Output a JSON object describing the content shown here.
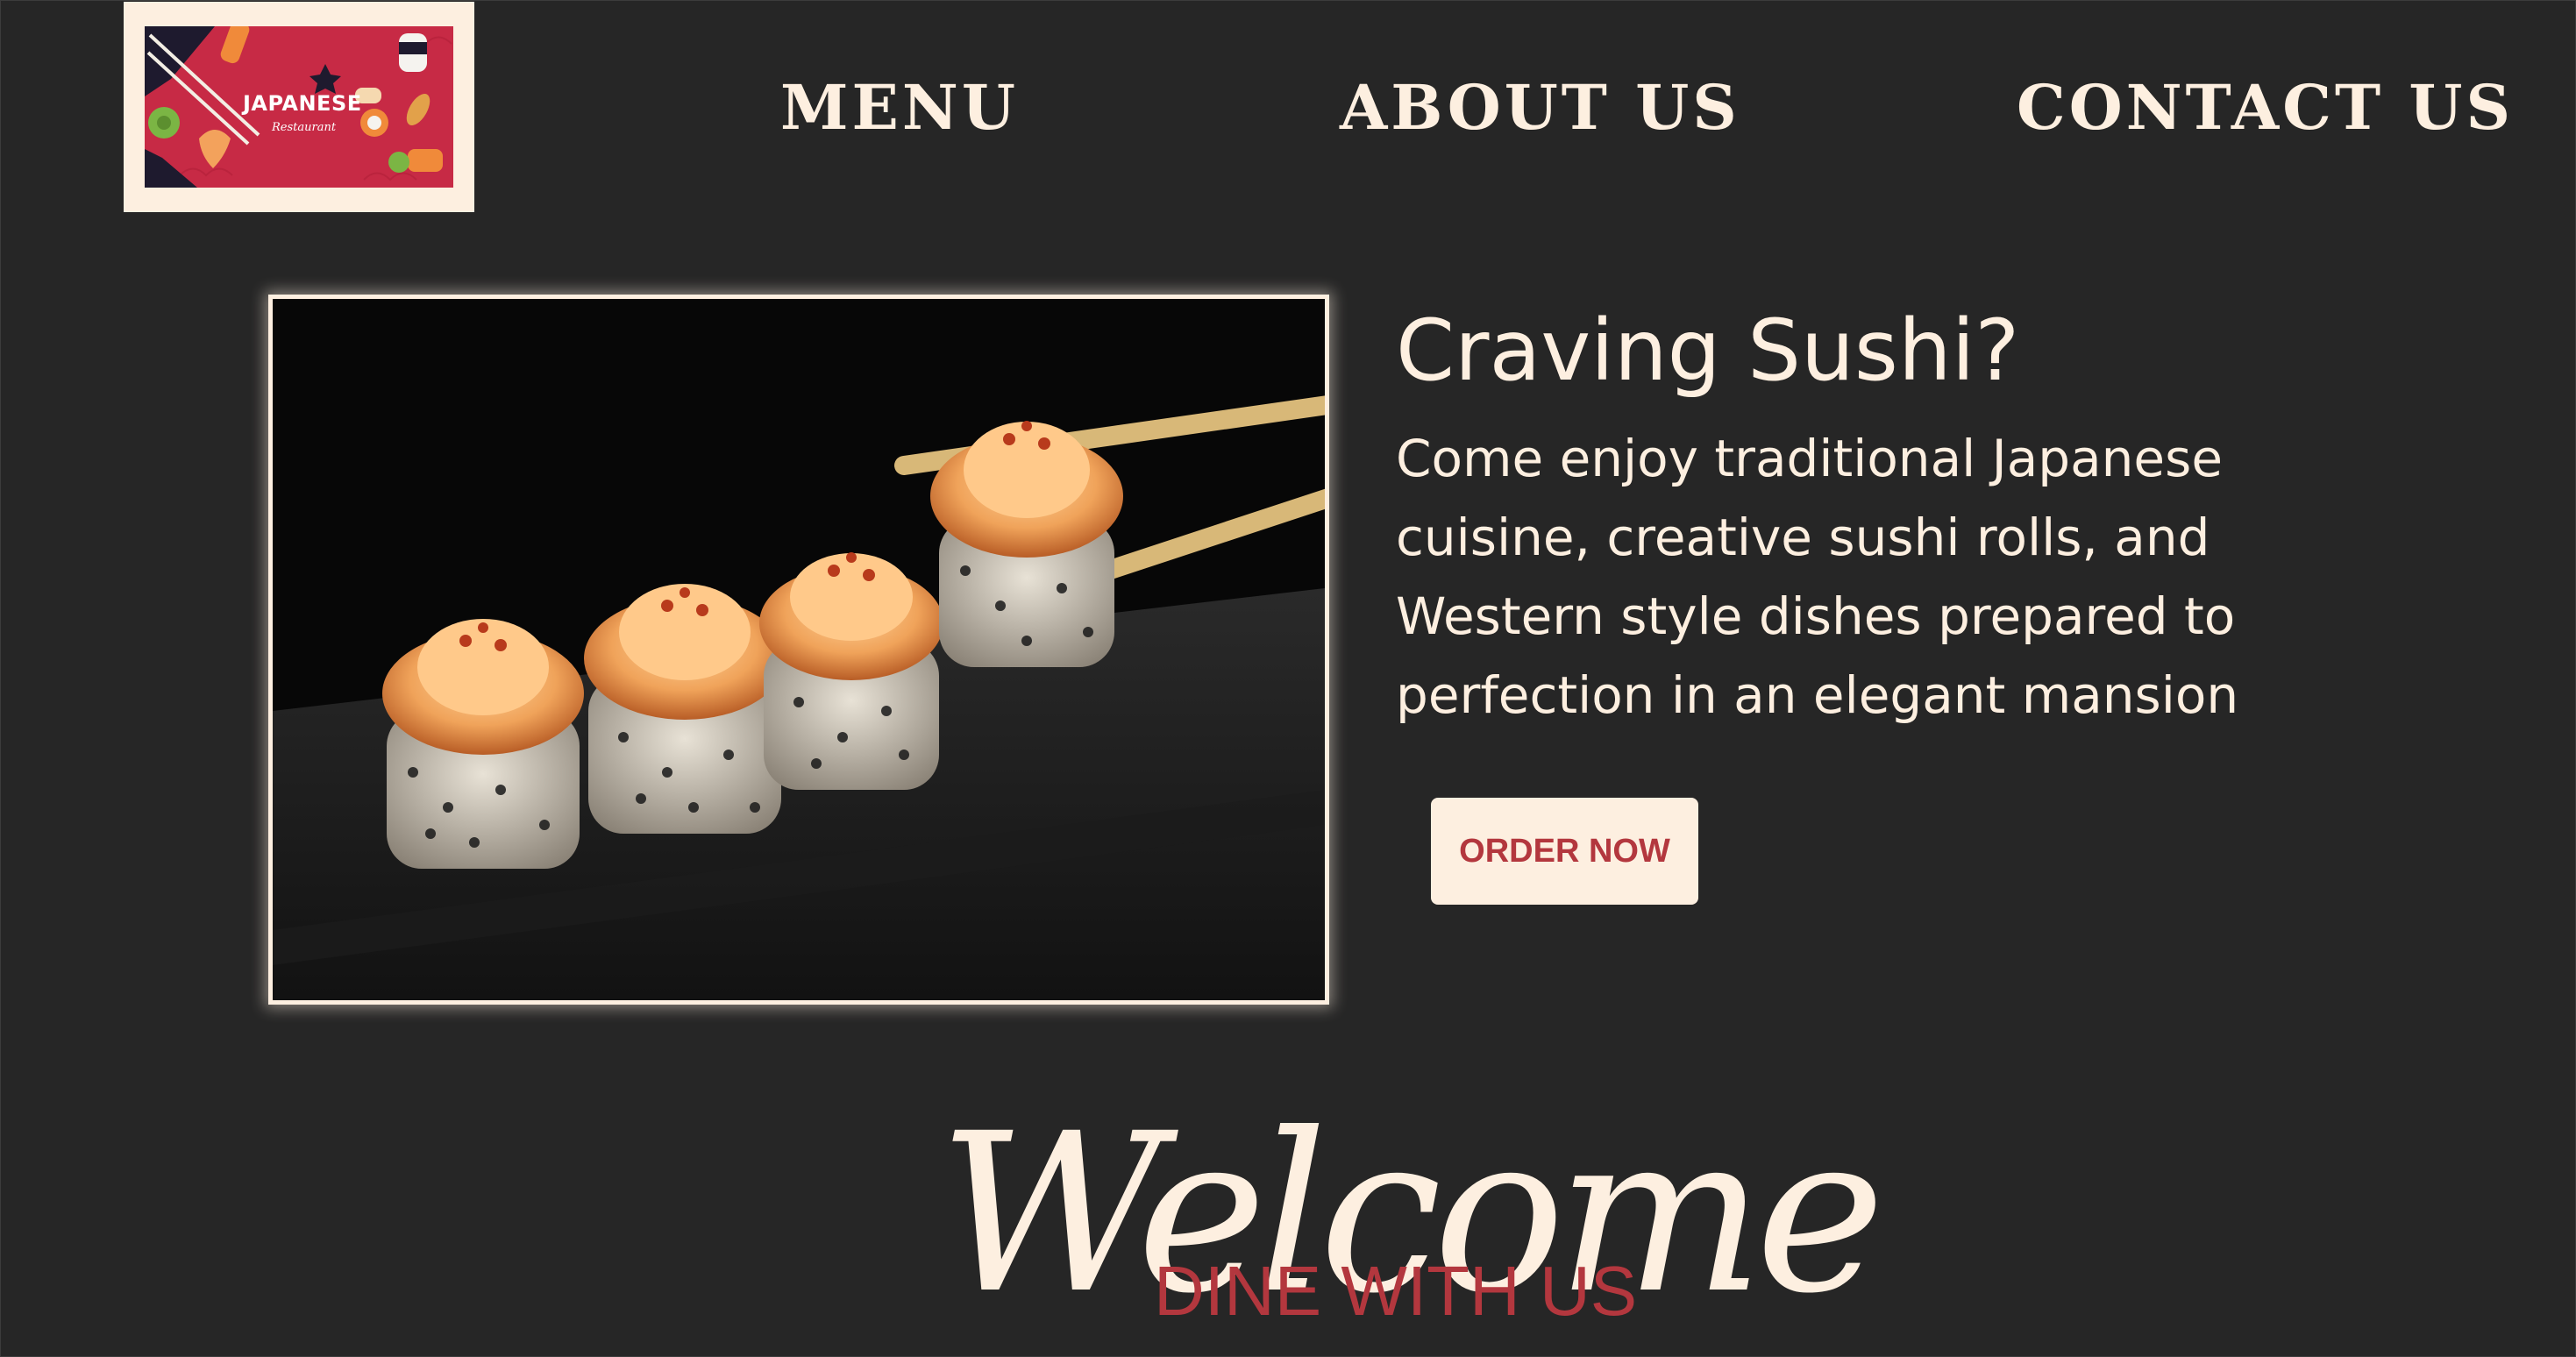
{
  "header": {
    "logo": {
      "title": "JAPANESE",
      "subtitle": "Restaurant"
    },
    "nav": [
      {
        "label": "MENU"
      },
      {
        "label": "ABOUT US"
      },
      {
        "label": "CONTACT US"
      }
    ]
  },
  "hero": {
    "title": "Craving Sushi?",
    "body": "Come enjoy traditional Japanese cuisine, creative sushi rolls, and Western style dishes prepared to perfection in an elegant mansion",
    "order_button": "ORDER NOW"
  },
  "welcome": {
    "script_heading": "Welcome",
    "tagline": "DINE WITH US"
  },
  "colors": {
    "background": "#262626",
    "cream": "#fdefe0",
    "accent_red": "#b3373e",
    "logo_red": "#c72a45"
  },
  "icons": [
    "chopsticks-icon",
    "sushi-icon",
    "leaf-icon",
    "shrimp-icon"
  ]
}
